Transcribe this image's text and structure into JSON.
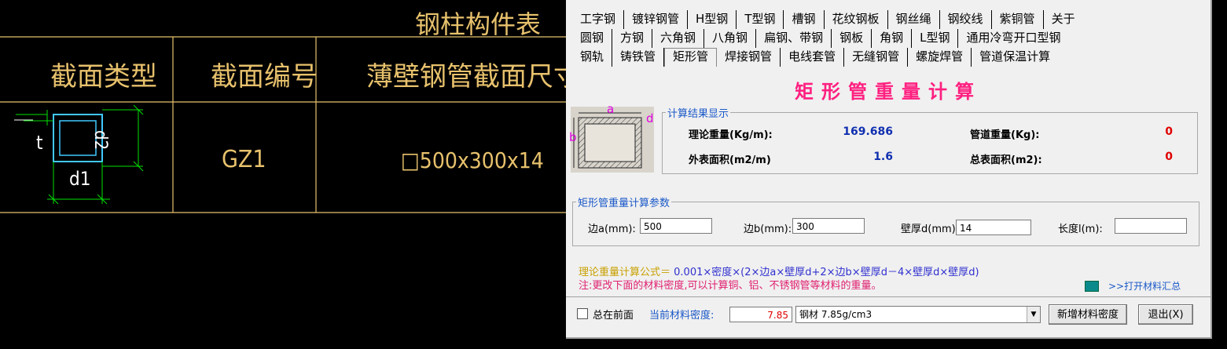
{
  "cad": {
    "table_title": "钢柱构件表",
    "headers": [
      "截面类型",
      "截面编号",
      "薄壁钢管截面尺寸(mm)"
    ],
    "row": {
      "code": "GZ1",
      "size": "□500x300x14"
    },
    "labels": {
      "t": "t",
      "d1": "d1",
      "d2": "d2"
    }
  },
  "tabs": {
    "row1": [
      "工字钢",
      "镀锌钢管",
      "H型钢",
      "T型钢",
      "槽钢",
      "花纹钢板",
      "钢丝绳",
      "钢绞线",
      "紫铜管",
      "关于"
    ],
    "row2": [
      "圆钢",
      "方钢",
      "六角钢",
      "八角钢",
      "扁钢、带钢",
      "钢板",
      "角钢",
      "L型钢",
      "通用冷弯开口型钢"
    ],
    "row3": [
      "钢轨",
      "铸铁管",
      "矩形管",
      "焊接钢管",
      "电线套管",
      "无缝钢管",
      "螺旋焊管",
      "管道保温计算"
    ],
    "active": "矩形管"
  },
  "title": "矩形管重量计算",
  "diagram": {
    "a": "a",
    "b": "b",
    "d": "d"
  },
  "result": {
    "legend": "计算结果显示",
    "weight_label": "理论重量(Kg/m):",
    "weight_value": "169.686",
    "pipe_weight_label": "管道重量(Kg):",
    "pipe_weight_value": "0",
    "surface_label": "外表面积(m2/m)",
    "surface_value": "1.6",
    "total_surface_label": "总表面积(m2):",
    "total_surface_value": "0"
  },
  "params": {
    "legend": "矩形管重量计算参数",
    "a_label": "边a(mm):",
    "a_value": "500",
    "b_label": "边b(mm):",
    "b_value": "300",
    "d_label": "壁厚d(mm)",
    "d_value": "14",
    "l_label": "长度l(m):",
    "l_value": ""
  },
  "formula": {
    "head": "理论重量计算公式＝",
    "body": " 0.001×密度×(2×边a×壁厚d+2×边b×壁厚d－4×壁厚d×壁厚d)"
  },
  "note": "注:更改下面的材料密度,可以计算铜、铝、不锈钢管等材料的重量。",
  "open_link": ">>打开材料汇总",
  "bottom": {
    "ontop_label": "总在前面",
    "density_label": "当前材料密度:",
    "density_value": "7.85",
    "material_selected": "钢材 7.85g/cm3",
    "add_density_btn": "新增材料密度",
    "exit_btn": "退出(X)"
  },
  "colors": {
    "cad_line": "#e7c16c",
    "dim_green": "#00e000",
    "section_cyan": "#40c8ff",
    "title_pink": "#ff2080"
  }
}
